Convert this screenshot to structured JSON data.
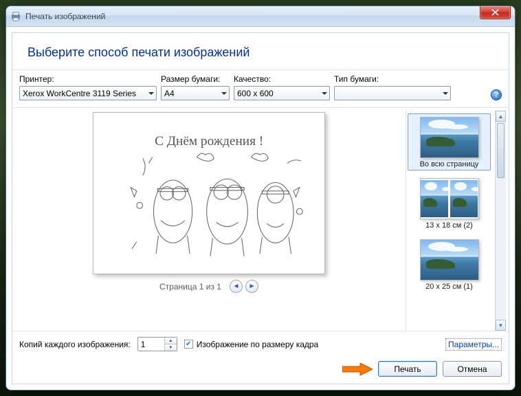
{
  "window": {
    "title": "Печать изображений"
  },
  "header": {
    "heading": "Выберите способ печати изображений"
  },
  "settings": {
    "printer_label": "Принтер:",
    "printer_value": "Xerox WorkCentre 3119 Series",
    "paper_size_label": "Размер бумаги:",
    "paper_size_value": "A4",
    "quality_label": "Качество:",
    "quality_value": "600 x 600",
    "paper_type_label": "Тип бумаги:",
    "paper_type_value": ""
  },
  "preview": {
    "page_caption": "С Днём рождения !",
    "pager_text": "Страница 1 из 1"
  },
  "layouts": [
    {
      "label": "Во всю страницу",
      "selected": true,
      "style": "single"
    },
    {
      "label": "13 x 18 см (2)",
      "selected": false,
      "style": "pair"
    },
    {
      "label": "20 x 25 см (1)",
      "selected": false,
      "style": "single"
    }
  ],
  "footer": {
    "copies_label": "Копий каждого изображения:",
    "copies_value": "1",
    "fit_label": "Изображение по размеру кадра",
    "fit_checked": true,
    "options_link": "Параметры...",
    "print_button": "Печать",
    "cancel_button": "Отмена"
  }
}
